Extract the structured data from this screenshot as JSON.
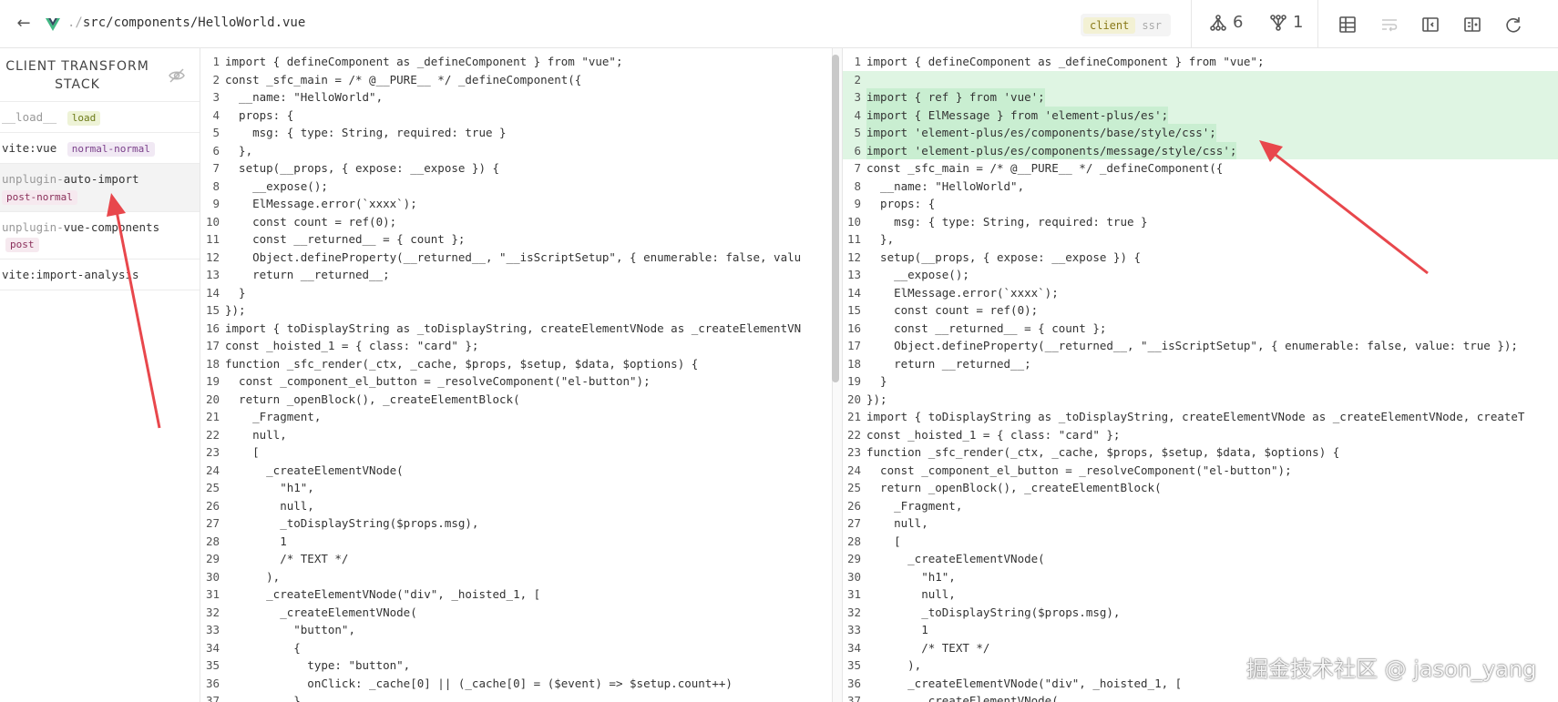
{
  "header": {
    "path_prefix": "./",
    "path": "src/components/HelloWorld.vue",
    "modes": [
      {
        "label": "client",
        "active": true
      },
      {
        "label": "ssr",
        "active": false
      }
    ],
    "counts": [
      {
        "icon": "graph-dependents-icon",
        "value": "6"
      },
      {
        "icon": "graph-imports-icon",
        "value": "1"
      }
    ],
    "tool_icons": [
      "table-icon",
      "wrap-text-icon",
      "sidebar-toggle-icon",
      "diff-compare-icon",
      "refresh-icon"
    ]
  },
  "sidebar": {
    "title_line1": "CLIENT TRANSFORM",
    "title_line2": "STACK",
    "items": [
      {
        "prefix": "",
        "name": "__load__",
        "badge": "load"
      },
      {
        "prefix": "vite:",
        "name": "vue",
        "badge": "normal-normal"
      },
      {
        "prefix": "unplugin-",
        "name": "auto-import",
        "badge": "post-normal"
      },
      {
        "prefix": "unplugin-",
        "name": "vue-components",
        "badge": "post"
      },
      {
        "prefix": "vite:",
        "name": "import-analysis",
        "badge": ""
      }
    ]
  },
  "left_code": [
    "import { defineComponent as _defineComponent } from \"vue\";",
    "const _sfc_main = /* @__PURE__ */ _defineComponent({",
    "  __name: \"HelloWorld\",",
    "  props: {",
    "    msg: { type: String, required: true }",
    "  },",
    "  setup(__props, { expose: __expose }) {",
    "    __expose();",
    "    ElMessage.error(`xxxx`);",
    "    const count = ref(0);",
    "    const __returned__ = { count };",
    "    Object.defineProperty(__returned__, \"__isScriptSetup\", { enumerable: false, valu",
    "    return __returned__;",
    "  }",
    "});",
    "import { toDisplayString as _toDisplayString, createElementVNode as _createElementVN",
    "const _hoisted_1 = { class: \"card\" };",
    "function _sfc_render(_ctx, _cache, $props, $setup, $data, $options) {",
    "  const _component_el_button = _resolveComponent(\"el-button\");",
    "  return _openBlock(), _createElementBlock(",
    "    _Fragment,",
    "    null,",
    "    [",
    "      _createElementVNode(",
    "        \"h1\",",
    "        null,",
    "        _toDisplayString($props.msg),",
    "        1",
    "        /* TEXT */",
    "      ),",
    "      _createElementVNode(\"div\", _hoisted_1, [",
    "        _createElementVNode(",
    "          \"button\",",
    "          {",
    "            type: \"button\",",
    "            onClick: _cache[0] || (_cache[0] = ($event) => $setup.count++)",
    "          },"
  ],
  "right_code": [
    "import { defineComponent as _defineComponent } from \"vue\";",
    "",
    "import { ref } from 'vue';",
    "import { ElMessage } from 'element-plus/es';",
    "import 'element-plus/es/components/base/style/css';",
    "import 'element-plus/es/components/message/style/css';",
    "const _sfc_main = /* @__PURE__ */ _defineComponent({",
    "  __name: \"HelloWorld\",",
    "  props: {",
    "    msg: { type: String, required: true }",
    "  },",
    "  setup(__props, { expose: __expose }) {",
    "    __expose();",
    "    ElMessage.error(`xxxx`);",
    "    const count = ref(0);",
    "    const __returned__ = { count };",
    "    Object.defineProperty(__returned__, \"__isScriptSetup\", { enumerable: false, value: true });",
    "    return __returned__;",
    "  }",
    "});",
    "import { toDisplayString as _toDisplayString, createElementVNode as _createElementVNode, createT",
    "const _hoisted_1 = { class: \"card\" };",
    "function _sfc_render(_ctx, _cache, $props, $setup, $data, $options) {",
    "  const _component_el_button = _resolveComponent(\"el-button\");",
    "  return _openBlock(), _createElementBlock(",
    "    _Fragment,",
    "    null,",
    "    [",
    "      _createElementVNode(",
    "        \"h1\",",
    "        null,",
    "        _toDisplayString($props.msg),",
    "        1",
    "        /* TEXT */",
    "      ),",
    "      _createElementVNode(\"div\", _hoisted_1, [",
    "        _createElementVNode("
  ],
  "right_added_lines": [
    2,
    3,
    4,
    5,
    6
  ],
  "watermark": "掘金技术社区 @ jason_yang",
  "colors": {
    "added_line": "#dff5e3",
    "added_text_bg": "#c9eed1",
    "arrow": "#e8474c",
    "vue_green": "#41b883",
    "vue_dark": "#35495e"
  }
}
